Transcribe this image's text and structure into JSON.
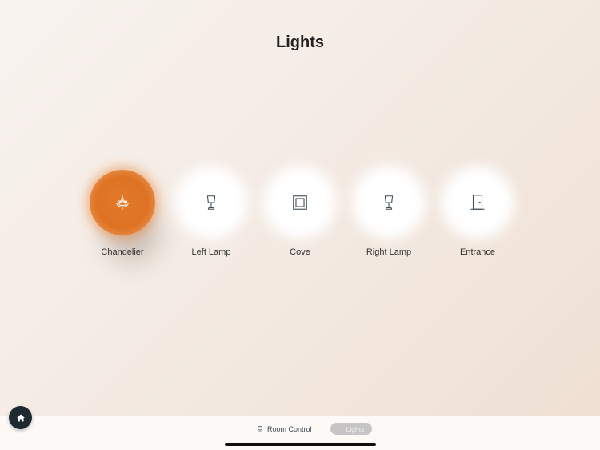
{
  "page": {
    "title": "Lights"
  },
  "lights": [
    {
      "label": "Chandelier",
      "icon": "chandelier-icon",
      "active": true
    },
    {
      "label": "Left Lamp",
      "icon": "lamp-icon",
      "active": false
    },
    {
      "label": "Cove",
      "icon": "cove-icon",
      "active": false
    },
    {
      "label": "Right Lamp",
      "icon": "lamp-icon",
      "active": false
    },
    {
      "label": "Entrance",
      "icon": "door-icon",
      "active": false
    }
  ],
  "bottom_bar": {
    "room_control_label": "Room Control",
    "lights_label": "Lights",
    "active_tab": "Lights"
  },
  "colors": {
    "accent": "#dd7222",
    "icon_stroke": "#3d4f58",
    "home_button": "#1e2a30"
  },
  "home_button": {
    "icon": "home-icon"
  }
}
